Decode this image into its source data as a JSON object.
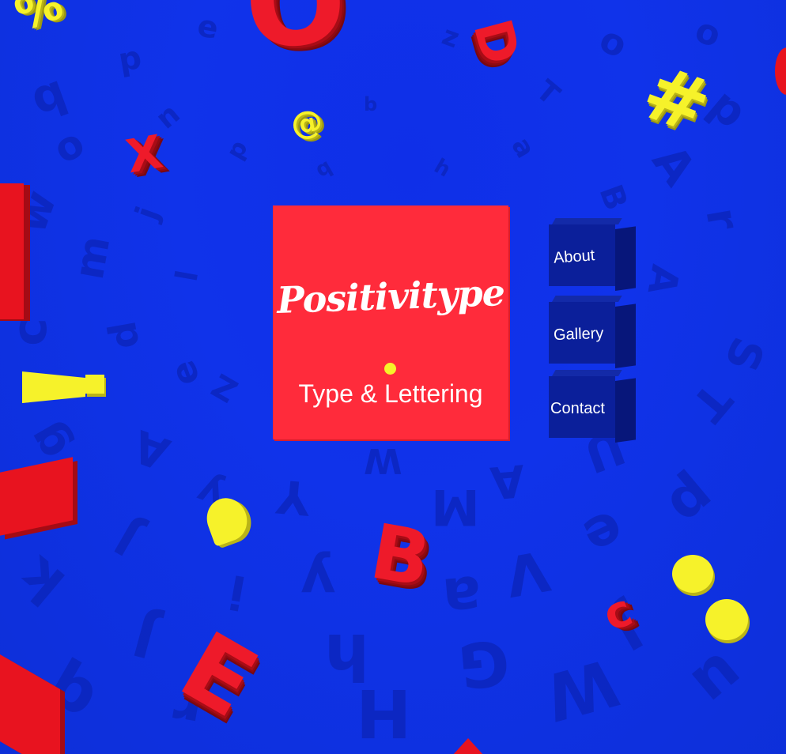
{
  "brand": {
    "name": "Positivitype",
    "tagline": "Type & Lettering"
  },
  "nav": {
    "items": [
      {
        "label": "About"
      },
      {
        "label": "Gallery"
      },
      {
        "label": "Contact"
      }
    ]
  },
  "decor": {
    "letters": {
      "red_x": "X",
      "red_b": "B",
      "red_e": "E",
      "red_o": "O",
      "red_d": "D",
      "red_c": "c",
      "yellow_hash": "#",
      "yellow_percent": "%",
      "yellow_at": "@"
    }
  },
  "colors": {
    "background": "#1234e6",
    "panel": "#ff2b3b",
    "nav_cube": "#0b1f9a",
    "accent_yellow": "#f6f22a",
    "accent_red": "#ee1a2a"
  }
}
